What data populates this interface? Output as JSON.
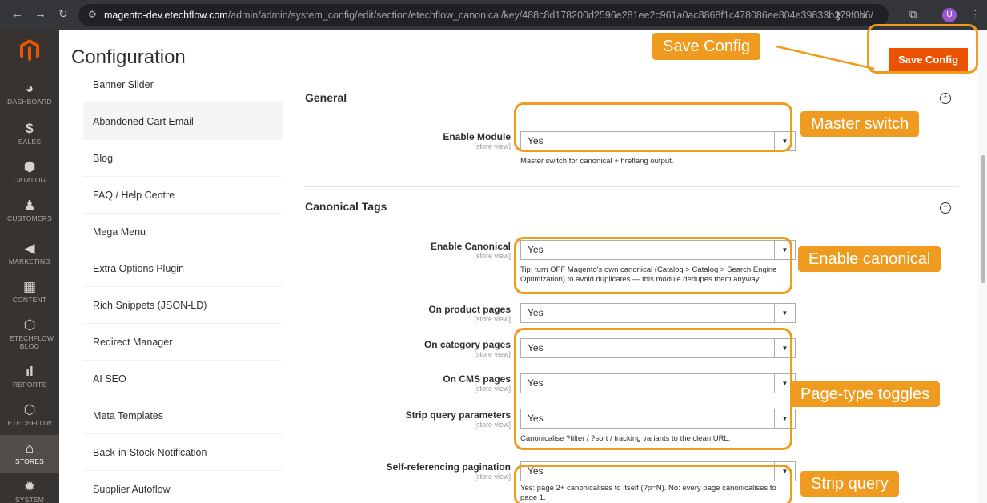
{
  "browser": {
    "url_host": "magento-dev.etechflow.com",
    "url_path": "/admin/admin/system_config/edit/section/etechflow_canonical/key/488c8d178200d2596e281ee2c961a0ac8868f1c478086ee804e39833b279f0b6/",
    "profile_initial": "U"
  },
  "admin_nav": [
    {
      "label": "DASHBOARD",
      "icon": "dashboard-icon"
    },
    {
      "label": "SALES",
      "icon": "dollar-icon"
    },
    {
      "label": "CATALOG",
      "icon": "cube-icon"
    },
    {
      "label": "CUSTOMERS",
      "icon": "person-icon"
    },
    {
      "label": "MARKETING",
      "icon": "megaphone-icon"
    },
    {
      "label": "CONTENT",
      "icon": "layout-icon"
    },
    {
      "label": "ETECHFLOW BLOG",
      "icon": "hexagon-icon"
    },
    {
      "label": "REPORTS",
      "icon": "bar-chart-icon"
    },
    {
      "label": "ETECHFLOW",
      "icon": "hexagon-icon"
    },
    {
      "label": "STORES",
      "icon": "store-icon"
    },
    {
      "label": "SYSTEM",
      "icon": "gear-icon"
    }
  ],
  "header": {
    "title": "Configuration",
    "save_label": "Save Config"
  },
  "config_sidebar": [
    "Banner Slider",
    "Abandoned Cart Email",
    "Blog",
    "FAQ / Help Centre",
    "Mega Menu",
    "Extra Options Plugin",
    "Rich Snippets (JSON-LD)",
    "Redirect Manager",
    "AI SEO",
    "Meta Templates",
    "Back-in-Stock Notification",
    "Supplier Autoflow"
  ],
  "sections": {
    "general": {
      "title": "General",
      "enable_module": {
        "label": "Enable Module",
        "scope": "[store view]",
        "value": "Yes",
        "note": "Master switch for canonical + hreflang output."
      }
    },
    "canonical": {
      "title": "Canonical Tags",
      "enable_canonical": {
        "label": "Enable Canonical",
        "scope": "[store view]",
        "value": "Yes",
        "note_line1": "Tip: turn OFF Magento's own canonical (Catalog > Catalog > Search Engine",
        "note_line2": "Optimization) to avoid duplicates — this module dedupes them anyway."
      },
      "product_pages": {
        "label": "On product pages",
        "scope": "[store view]",
        "value": "Yes"
      },
      "category_pages": {
        "label": "On category pages",
        "scope": "[store view]",
        "value": "Yes"
      },
      "cms_pages": {
        "label": "On CMS pages",
        "scope": "[store view]",
        "value": "Yes"
      },
      "strip_query": {
        "label": "Strip query parameters",
        "scope": "[store view]",
        "value": "Yes",
        "note": "Canonicalise ?filter / ?sort / tracking variants to the clean URL."
      },
      "self_ref_pagination": {
        "label": "Self-referencing pagination",
        "scope": "[store view]",
        "value": "Yes",
        "note_line1": "Yes: page 2+ canonicalises to itself (?p=N). No: every page canonicalises to",
        "note_line2": "page 1."
      }
    }
  },
  "callouts": {
    "save_config": "Save Config",
    "master_switch": "Master switch",
    "enable_canonical": "Enable canonical",
    "page_type_toggles": "Page-type toggles",
    "strip_query": "Strip query"
  },
  "colors": {
    "accent": "#eb5202",
    "callout": "#ef9b1f",
    "nav_bg": "#373330"
  }
}
